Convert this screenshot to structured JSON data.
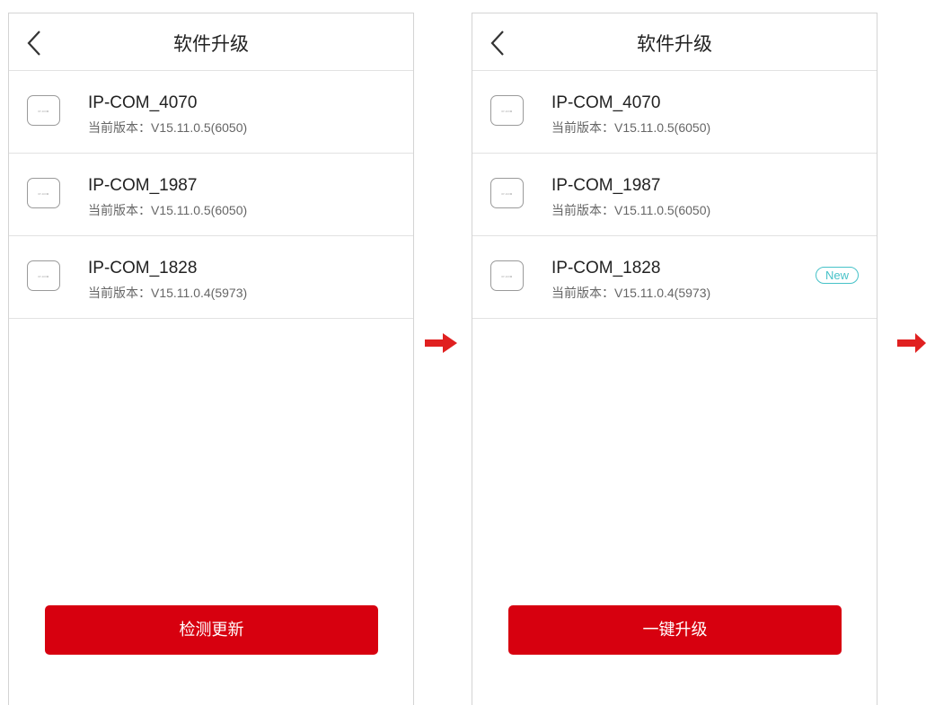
{
  "accent_color": "#d7000f",
  "badge_color": "#46c2c8",
  "screens": [
    {
      "title": "软件升级",
      "devices": [
        {
          "name": "IP-COM_4070",
          "version": "当前版本：V15.11.0.5(6050)",
          "logo": "IP-COM"
        },
        {
          "name": "IP-COM_1987",
          "version": "当前版本：V15.11.0.5(6050)",
          "logo": "IP-COM"
        },
        {
          "name": "IP-COM_1828",
          "version": "当前版本：V15.11.0.4(5973)",
          "logo": "IP-COM"
        }
      ],
      "button_label": "检测更新"
    },
    {
      "title": "软件升级",
      "devices": [
        {
          "name": "IP-COM_4070",
          "version": "当前版本：V15.11.0.5(6050)",
          "logo": "IP-COM"
        },
        {
          "name": "IP-COM_1987",
          "version": "当前版本：V15.11.0.5(6050)",
          "logo": "IP-COM"
        },
        {
          "name": "IP-COM_1828",
          "version": "当前版本：V15.11.0.4(5973)",
          "logo": "IP-COM",
          "badge": "New"
        }
      ],
      "button_label": "一键升级"
    }
  ],
  "icons": {
    "back": "chevron-left-icon",
    "next_step": "arrow-right-icon",
    "device": "router-device-icon"
  }
}
